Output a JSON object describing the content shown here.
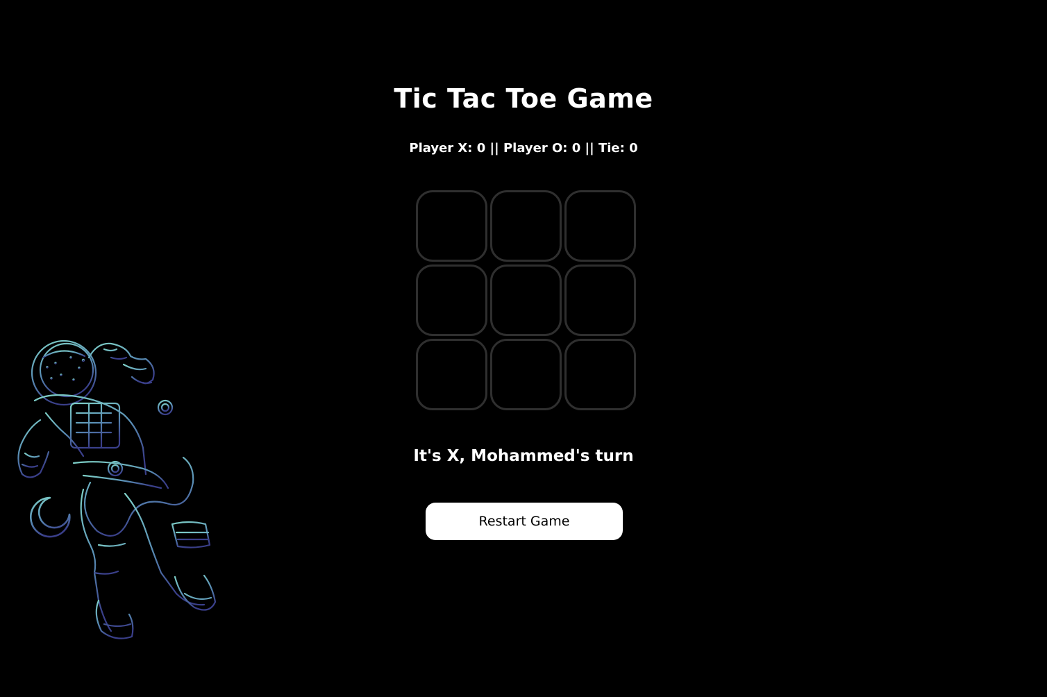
{
  "game": {
    "title": "Tic Tac Toe Game",
    "score_text": "Player X: 0 || Player O: 0 || Tie: 0",
    "board": [
      "",
      "",
      "",
      "",
      "",
      "",
      "",
      "",
      ""
    ],
    "status_text": "It's X, Mohammed's turn",
    "restart_label": "Restart Game"
  },
  "decoration": {
    "illustration_icon": "astronaut-icon",
    "gradient_top_color": "#7fd1c8",
    "gradient_bottom_color": "#3a3f8a"
  },
  "colors": {
    "background": "#000000",
    "text": "#ffffff",
    "cell_border": "#2f2f2f",
    "button_background": "#ffffff"
  }
}
